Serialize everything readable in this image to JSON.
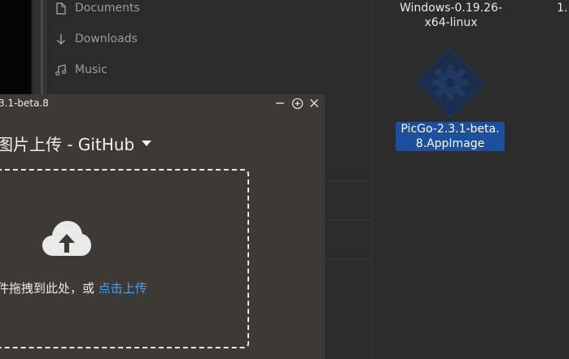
{
  "sidebar": {
    "items": [
      {
        "label": "Documents",
        "icon": "document-icon"
      },
      {
        "label": "Downloads",
        "icon": "download-arrow-icon"
      },
      {
        "label": "Music",
        "icon": "music-note-icon"
      }
    ]
  },
  "files": [
    {
      "label_line1": "Windows-0.19.26-",
      "label_line2": "x64-linux",
      "selected": false
    },
    {
      "label_line1": "PicGo-2.3.1-beta.",
      "label_line2": "8.AppImage",
      "selected": true,
      "icon": "picgo-gear-icon"
    }
  ],
  "partial_file_label": "1.",
  "picgo": {
    "window_title": "3.1-beta.8",
    "picbed_title": "图片上传 - GitHub",
    "drop_text": "件拖拽到此处，或 ",
    "drop_link": "点击上传",
    "accent_color": "#4a9de8"
  },
  "colors": {
    "selection": "#1c4f9c",
    "window_bg": "#3d3a36"
  }
}
